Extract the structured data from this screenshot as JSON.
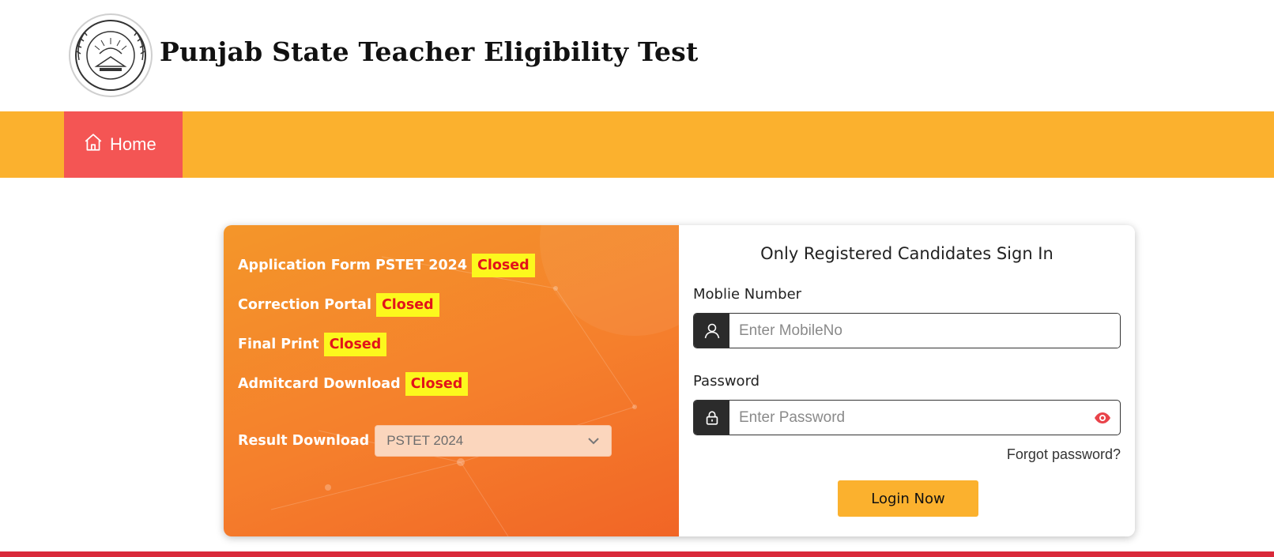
{
  "header": {
    "title": "Punjab State Teacher Eligibility Test",
    "logo_icon": "psseb-emblem-icon"
  },
  "nav": {
    "home_label": "Home",
    "home_icon": "home-icon",
    "bar_color": "#fbb12e",
    "active_color": "#f45554"
  },
  "status_panel": {
    "items": [
      {
        "label": "Application Form PSTET 2024",
        "status": "Closed"
      },
      {
        "label": "Correction Portal",
        "status": "Closed"
      },
      {
        "label": "Final Print",
        "status": "Closed"
      },
      {
        "label": "Admitcard Download",
        "status": "Closed"
      }
    ],
    "result": {
      "label": "Result Download",
      "selected": "PSTET 2024"
    }
  },
  "signin": {
    "title": "Only Registered Candidates Sign In",
    "mobile_label": "Moblie Number",
    "mobile_placeholder": "Enter MobileNo",
    "password_label": "Password",
    "password_placeholder": "Enter Password",
    "forgot": "Forgot password?",
    "login_button": "Login Now"
  },
  "colors": {
    "accent": "#fbb12e",
    "badge_bg": "#fcf81d",
    "badge_text": "#e3131b",
    "footer": "#d9293a"
  }
}
